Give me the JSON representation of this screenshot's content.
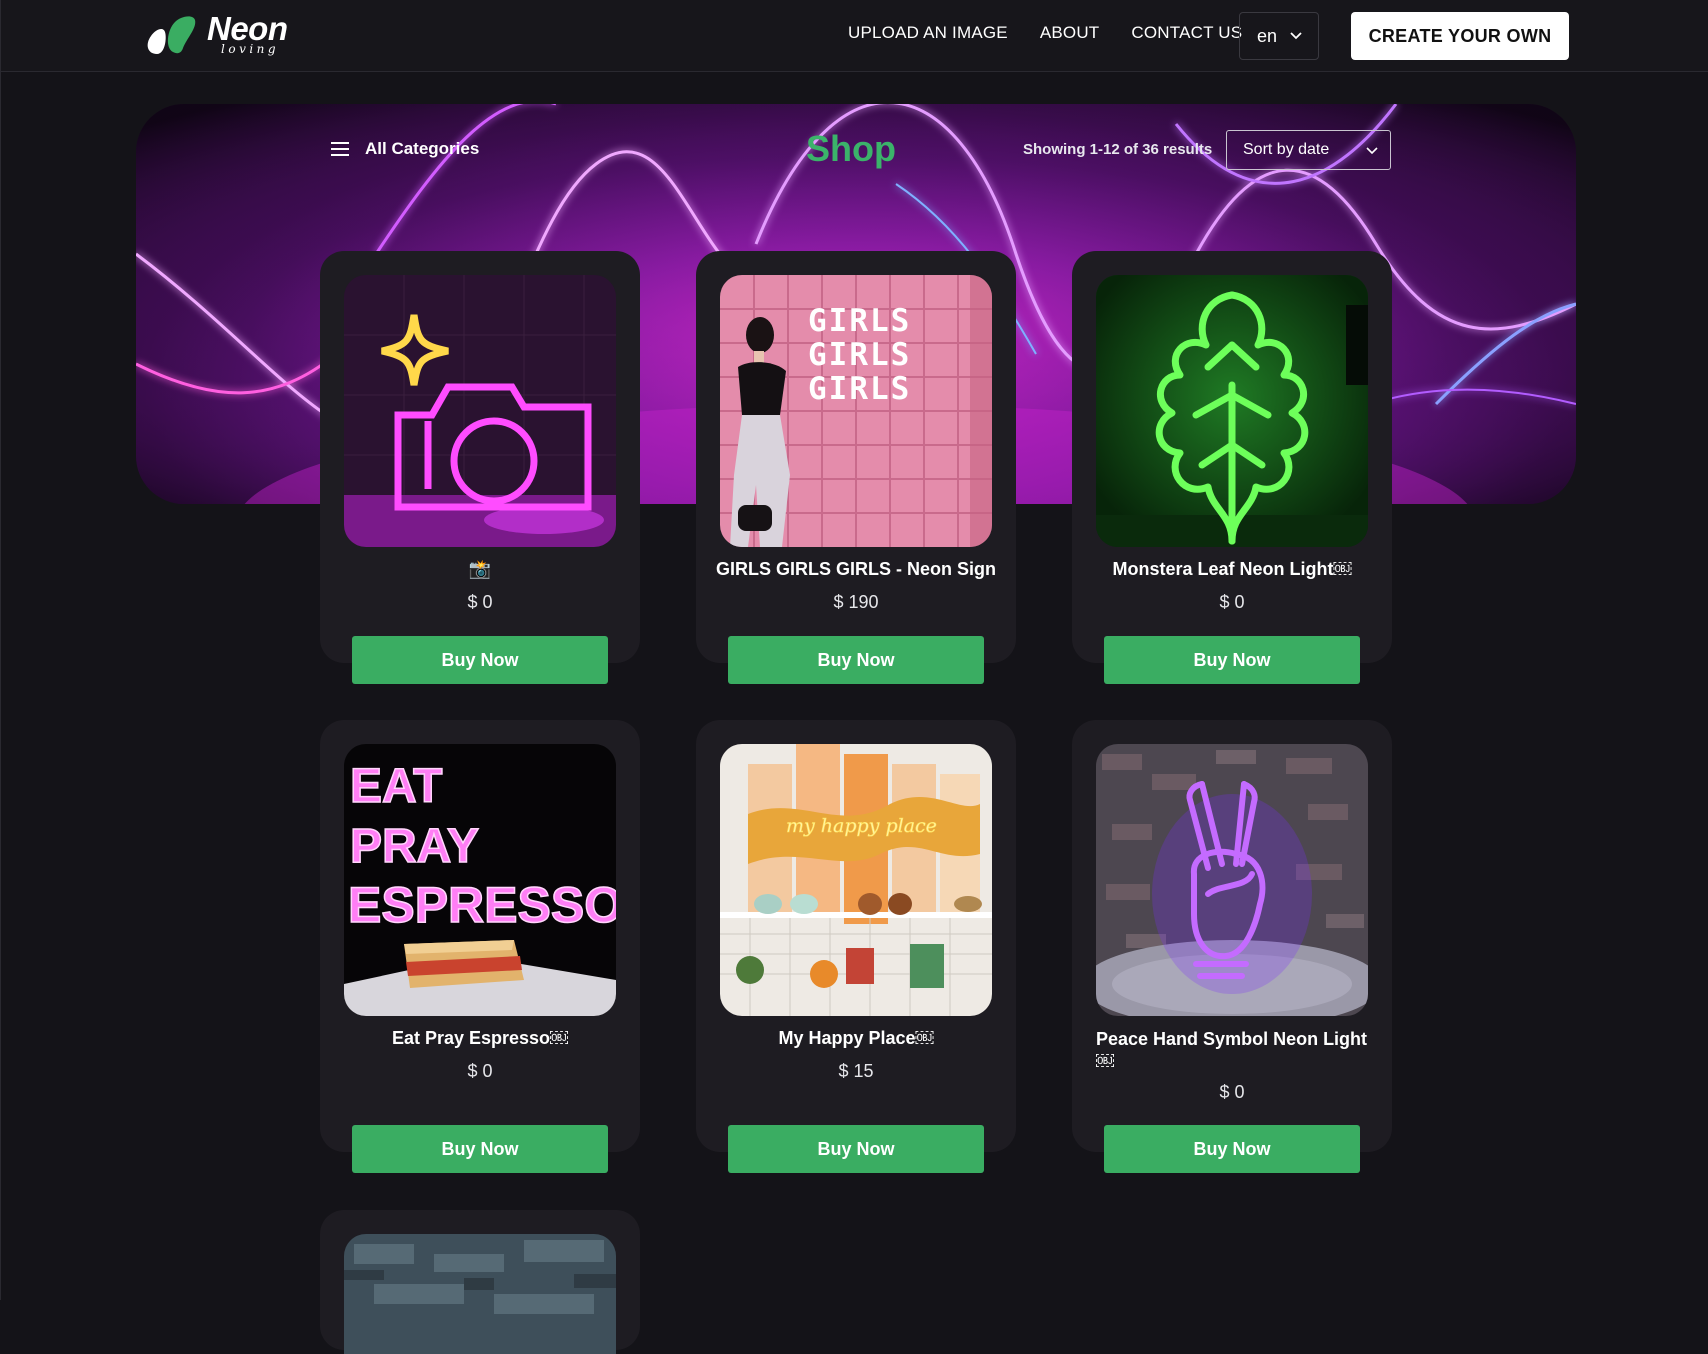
{
  "header": {
    "logo_word": "Neon",
    "logo_sub": "loving",
    "nav": [
      {
        "label": "UPLOAD AN IMAGE"
      },
      {
        "label": "ABOUT"
      },
      {
        "label": "CONTACT US"
      }
    ],
    "language": "en",
    "create_label": "CREATE YOUR OWN"
  },
  "toolbar": {
    "categories_label": "All Categories",
    "title": "Shop",
    "results_text": "Showing 1-12 of 36 results",
    "sort_value": "Sort by date"
  },
  "colors": {
    "accent_green": "#3aad62",
    "background": "#141318",
    "card": "#1e1c22"
  },
  "products": [
    {
      "name": "📸",
      "price": "$ 0",
      "button": "Buy Now"
    },
    {
      "name": "GIRLS GIRLS GIRLS - Neon Sign",
      "price": "$ 190",
      "button": "Buy Now"
    },
    {
      "name": "Monstera Leaf Neon Light￼",
      "price": "$ 0",
      "button": "Buy Now"
    },
    {
      "name": "Eat Pray Espresso￼",
      "price": "$ 0",
      "button": "Buy Now"
    },
    {
      "name": "My Happy Place￼",
      "price": "$ 15",
      "button": "Buy Now"
    },
    {
      "name": "Peace Hand Symbol Neon Light ￼",
      "price": "$ 0",
      "button": "Buy Now"
    }
  ],
  "images": {
    "girls_sign": "GIRLS",
    "espresso_sign": [
      "EAT",
      "PRAY",
      "ESPRESSO"
    ],
    "happy_place_sign": "my happy place"
  }
}
